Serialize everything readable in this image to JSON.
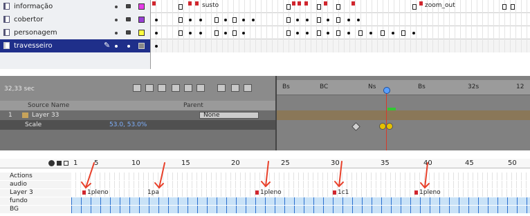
{
  "panel1": {
    "layers": [
      {
        "name": "informação",
        "swatch": "#e63ce8"
      },
      {
        "name": "cobertor",
        "swatch": "#9a3fd6"
      },
      {
        "name": "personagem",
        "swatch": "#ffff40"
      },
      {
        "name": "travesseiro",
        "swatch": "#888888"
      }
    ],
    "frame_labels": {
      "susto": "susto",
      "zoom_out": "zoom_out"
    }
  },
  "panel2": {
    "timecode": "32,33 sec",
    "ruler_ticks": [
      "Bs",
      "BC",
      "Ns",
      "Bs",
      "32s",
      "12"
    ],
    "columns": {
      "source_name": "Source Name",
      "parent": "Parent"
    },
    "layer": {
      "index": "1",
      "name": "Layer 33",
      "parent_value": "None"
    },
    "sublayer": {
      "name": "Scale",
      "value": "53.0, 53.0%"
    }
  },
  "panel3": {
    "ruler_numbers": [
      "1",
      "5",
      "10",
      "15",
      "20",
      "25",
      "30",
      "35",
      "40",
      "45",
      "50"
    ],
    "layers": [
      {
        "name": "Actions"
      },
      {
        "name": "audio"
      },
      {
        "name": "Layer 3"
      },
      {
        "name": "fundo"
      },
      {
        "name": "BG"
      }
    ],
    "labels": {
      "l1": "1pleno",
      "l2": "1pa",
      "l3": "1pleno",
      "l4": "1c1",
      "l5": "1pleno"
    },
    "arrow_color": "#e8402a"
  }
}
